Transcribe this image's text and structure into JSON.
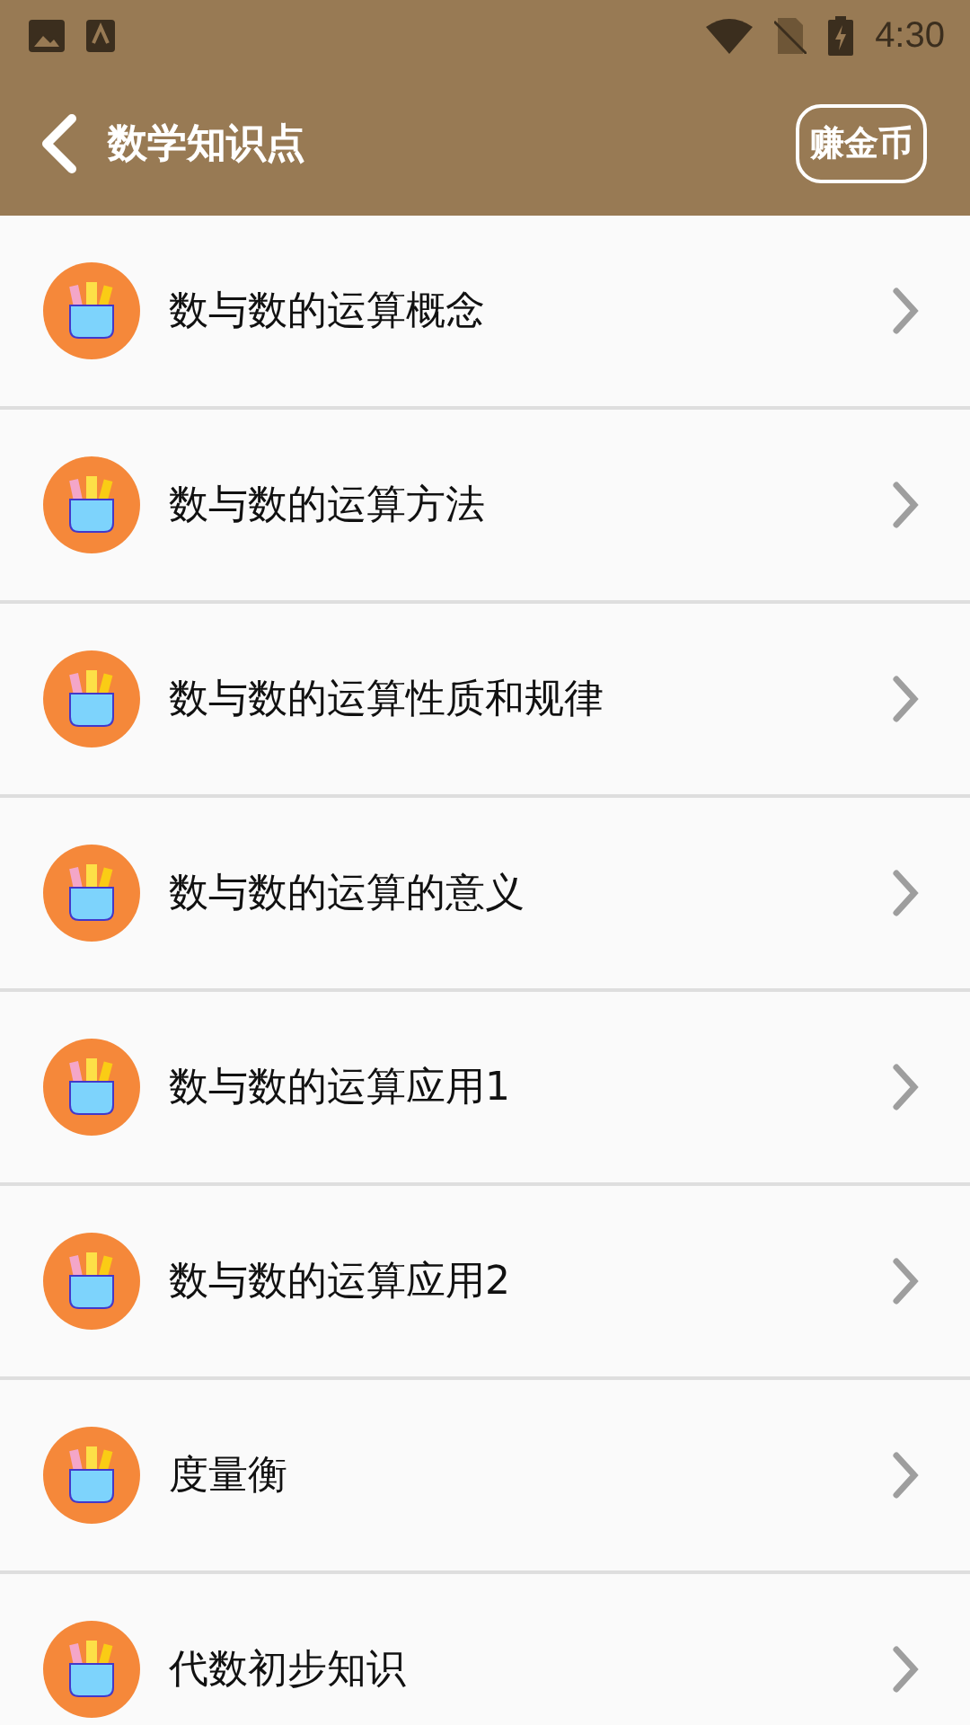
{
  "status_bar": {
    "time": "4:30"
  },
  "toolbar": {
    "title": "数学知识点",
    "action": "赚金币"
  },
  "items": [
    {
      "label": "数与数的运算概念"
    },
    {
      "label": "数与数的运算方法"
    },
    {
      "label": "数与数的运算性质和规律"
    },
    {
      "label": "数与数的运算的意义"
    },
    {
      "label": "数与数的运算应用1"
    },
    {
      "label": "数与数的运算应用2"
    },
    {
      "label": "度量衡"
    },
    {
      "label": "代数初步知识"
    }
  ]
}
